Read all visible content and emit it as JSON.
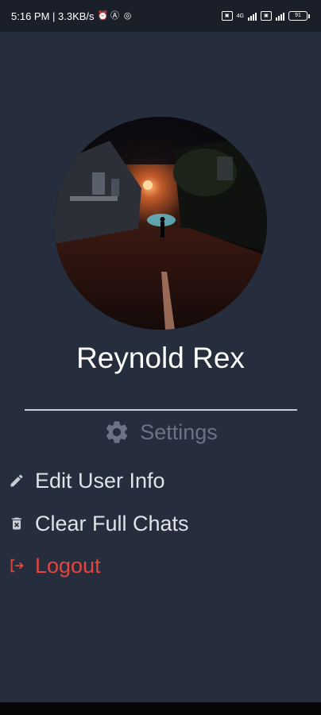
{
  "status_bar": {
    "time_speed": "5:16 PM | 3.3KB/s",
    "sim1_label": "4G",
    "battery": "91"
  },
  "profile": {
    "name": "Reynold Rex"
  },
  "settings": {
    "title": "Settings",
    "icon": "gear-icon"
  },
  "menu": {
    "items": [
      {
        "label": "Edit User Info",
        "icon": "pencil-icon"
      },
      {
        "label": "Clear Full Chats",
        "icon": "trash-icon"
      },
      {
        "label": "Logout",
        "icon": "logout-icon"
      }
    ]
  },
  "colors": {
    "background": "#262d3d",
    "status_bar": "#1a1f2a",
    "settings_muted": "#6b7384",
    "text": "#dfe2e8",
    "logout": "#e2473f"
  }
}
